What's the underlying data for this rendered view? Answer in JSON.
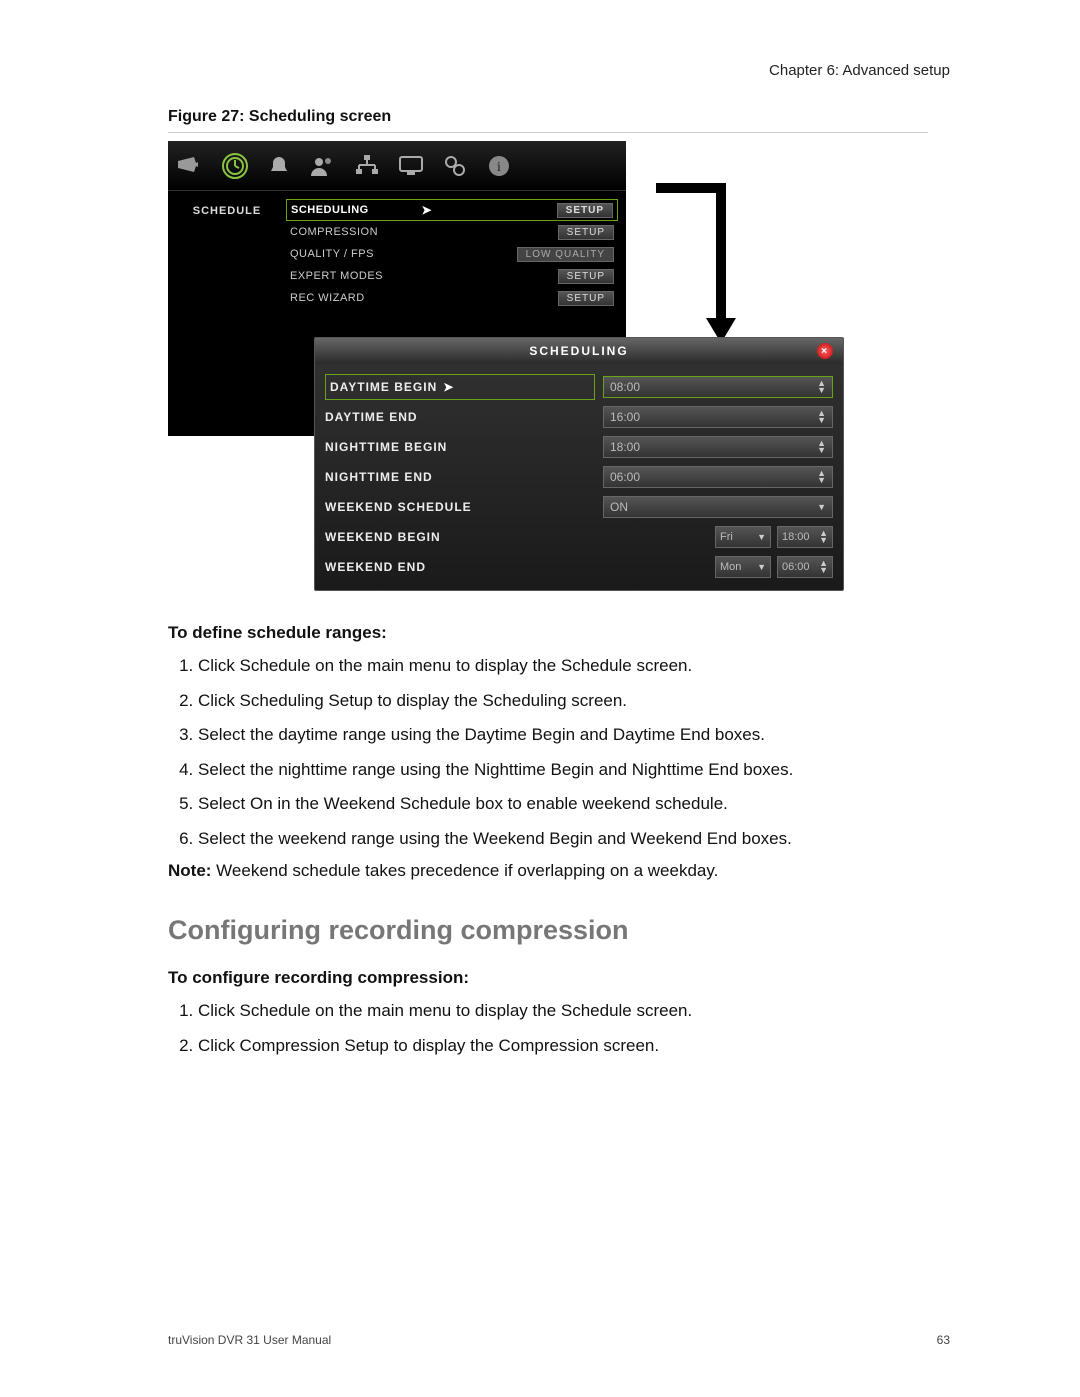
{
  "header": {
    "chapter": "Chapter 6: Advanced setup"
  },
  "figure": {
    "caption": "Figure 27: Scheduling screen",
    "sidebar_label": "SCHEDULE",
    "menu": {
      "rows": [
        {
          "label": "SCHEDULING",
          "action": "SETUP",
          "selected": true
        },
        {
          "label": "COMPRESSION",
          "action": "SETUP",
          "selected": false
        },
        {
          "label": "QUALITY / FPS",
          "action": "LOW QUALITY",
          "selected": false
        },
        {
          "label": "EXPERT MODES",
          "action": "SETUP",
          "selected": false
        },
        {
          "label": "REC WIZARD",
          "action": "SETUP",
          "selected": false
        }
      ]
    },
    "popup": {
      "title": "SCHEDULING",
      "rows": [
        {
          "label": "DAYTIME BEGIN",
          "value": "08:00",
          "selected": true
        },
        {
          "label": "DAYTIME END",
          "value": "16:00",
          "selected": false
        },
        {
          "label": "NIGHTTIME BEGIN",
          "value": "18:00",
          "selected": false
        },
        {
          "label": "NIGHTTIME END",
          "value": "06:00",
          "selected": false
        },
        {
          "label": "WEEKEND SCHEDULE",
          "value": "ON",
          "selected": false
        }
      ],
      "weekend_begin": {
        "label": "WEEKEND BEGIN",
        "day": "Fri",
        "time": "18:00"
      },
      "weekend_end": {
        "label": "WEEKEND END",
        "day": "Mon",
        "time": "06:00"
      }
    }
  },
  "section1": {
    "heading": "To define schedule ranges:",
    "steps": [
      "Click Schedule on the main menu to display the Schedule screen.",
      "Click Scheduling Setup to display the Scheduling screen.",
      "Select the daytime range using the Daytime Begin and Daytime End boxes.",
      "Select the nighttime range using the Nighttime Begin and Nighttime End boxes.",
      "Select On in the Weekend Schedule box to enable weekend schedule.",
      "Select the weekend range using the Weekend Begin and Weekend End boxes."
    ],
    "note_label": "Note:",
    "note_text": " Weekend schedule takes precedence if overlapping on a weekday."
  },
  "h2": "Configuring recording compression",
  "section2": {
    "heading": "To configure recording compression:",
    "steps": [
      "Click Schedule on the main menu to display the Schedule screen.",
      "Click Compression Setup to display the Compression screen."
    ]
  },
  "footer": {
    "left": "truVision DVR 31 User Manual",
    "right": "63"
  }
}
